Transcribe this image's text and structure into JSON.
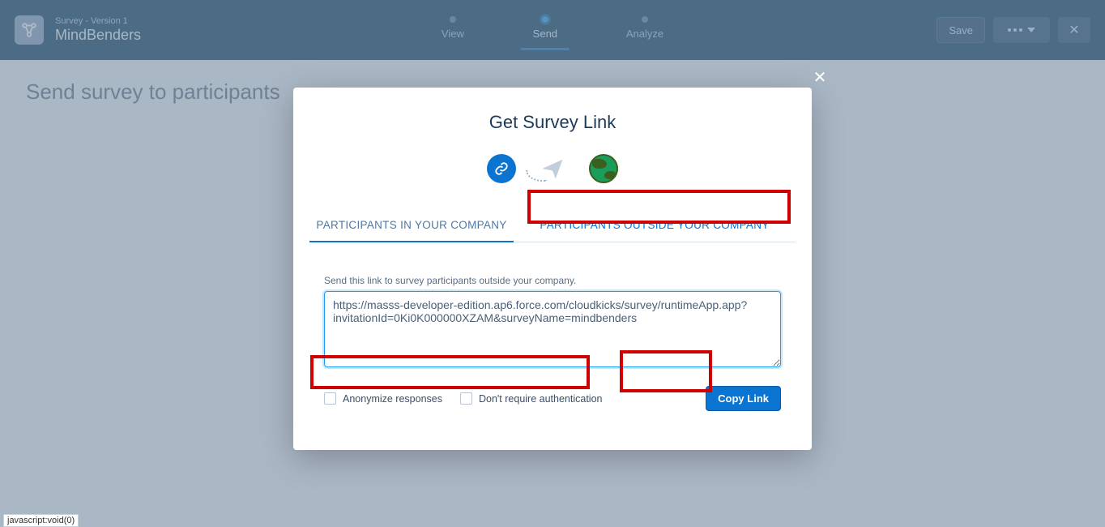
{
  "header": {
    "line1": "Survey - Version 1",
    "title": "MindBenders",
    "steps": {
      "view": "View",
      "send": "Send",
      "analyze": "Analyze"
    },
    "save": "Save"
  },
  "page": {
    "heading": "Send survey to participants"
  },
  "modal": {
    "title": "Get Survey Link",
    "tabs": {
      "inside": "PARTICIPANTS IN YOUR COMPANY",
      "outside": "PARTICIPANTS OUTSIDE YOUR COMPANY"
    },
    "hint": "Send this link to survey participants outside your company.",
    "link_value": "https://masss-developer-edition.ap6.force.com/cloudkicks/survey/runtimeApp.app?invitationId=0Ki0K000000XZAM&surveyName=mindbenders",
    "options": {
      "anonymize": "Anonymize responses",
      "noauth": "Don't require authentication"
    },
    "copy": "Copy Link"
  },
  "status": {
    "text": "javascript:void(0)"
  }
}
